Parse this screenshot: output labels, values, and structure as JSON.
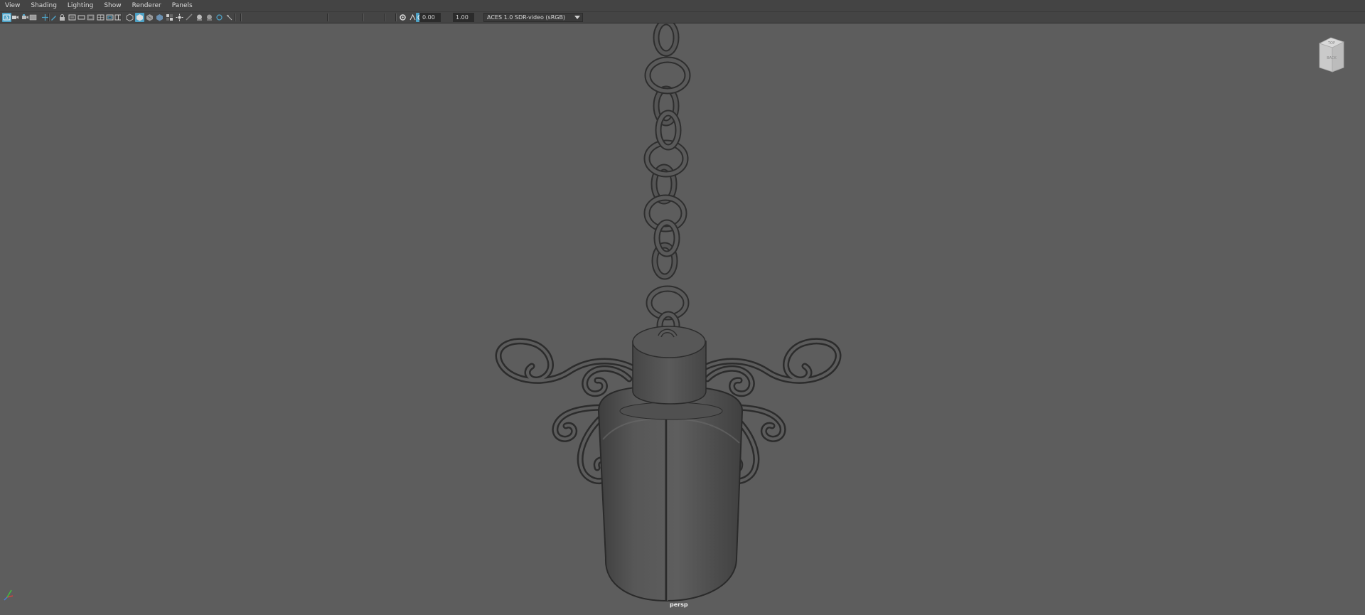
{
  "menu": [
    "View",
    "Shading",
    "Lighting",
    "Show",
    "Renderer",
    "Panels"
  ],
  "toolbar": {
    "icons": [
      {
        "name": "select-camera-icon",
        "active": true
      },
      {
        "name": "camera-attributes-icon",
        "active": false
      },
      {
        "name": "bookmarks-icon",
        "active": false
      },
      {
        "name": "image-plane-icon",
        "active": false
      },
      {
        "name": "2d-pan-zoom-icon",
        "active": false
      },
      {
        "name": "grease-pencil-icon",
        "active": false
      },
      {
        "name": "lock-camera-icon",
        "active": false
      },
      {
        "name": "film-gate-icon",
        "active": false
      },
      {
        "name": "resolution-gate-icon",
        "active": false
      },
      {
        "name": "gate-mask-icon",
        "active": false
      },
      {
        "name": "field-chart-icon",
        "active": false
      },
      {
        "name": "safe-action-icon",
        "active": false
      },
      {
        "name": "safe-title-icon",
        "active": false
      },
      {
        "name": "wireframe-icon",
        "active": false
      },
      {
        "name": "smooth-shade-icon",
        "active": true
      },
      {
        "name": "textured-icon",
        "active": false
      },
      {
        "name": "use-all-lights-icon",
        "active": false
      },
      {
        "name": "shadows-icon",
        "active": false
      },
      {
        "name": "ambient-occlusion-icon",
        "active": false
      },
      {
        "name": "anti-aliasing-icon",
        "active": false
      },
      {
        "name": "isolate-select-icon",
        "active": false
      },
      {
        "name": "xray-icon",
        "active": false
      },
      {
        "name": "xray-joints-icon",
        "active": false
      },
      {
        "name": "backface-culling-icon",
        "active": false
      },
      {
        "name": "exposure-icon",
        "active": false
      },
      {
        "name": "gamma-icon",
        "active": false
      },
      {
        "name": "color-management-icon",
        "active": true
      }
    ],
    "exposure_value": "0.00",
    "gamma_value": "1.00",
    "view_transform": "ACES 1.0 SDR-video (sRGB)"
  },
  "viewport": {
    "camera_label": "persp",
    "background_color": "#5d5d5d",
    "viewcube_labels": {
      "top": "TOP",
      "front": "BACK"
    }
  },
  "colors": {
    "menubar_bg": "#444444",
    "active_icon": "#4ea2c6",
    "axis_x": "#d04040",
    "axis_y": "#40c040",
    "axis_z": "#4a7bd8"
  }
}
